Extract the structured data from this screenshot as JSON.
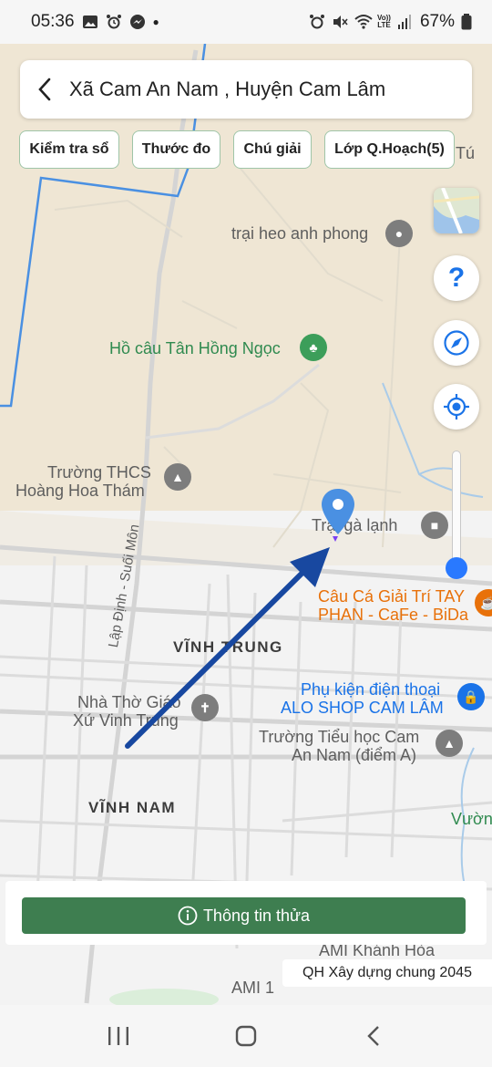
{
  "status_bar": {
    "time": "05:36",
    "battery_percent": "67%",
    "network_label_top": "Vo))",
    "network_label_bottom": "LTE"
  },
  "header": {
    "title": "Xã Cam An Nam , Huyện Cam Lâm"
  },
  "chips": [
    {
      "label": "Kiểm tra sổ"
    },
    {
      "label": "Thước đo"
    },
    {
      "label": "Chú giải"
    },
    {
      "label": "Lớp Q.Hoạch(5)"
    }
  ],
  "map": {
    "pois": {
      "trai_heo": "trại heo anh phong",
      "ho_cau": "Hồ câu Tân Hồng Ngọc",
      "truong_thcs_1": "Trường THCS",
      "truong_thcs_2": "Hoàng Hoa Thám",
      "trai_ga_1": "Trại gà lạnh",
      "cau_ca_1": "Câu Cá Giải Trí TAY",
      "cau_ca_2": "PHAN - CaFe - BiDa",
      "phu_kien_1": "Phụ kiện điện thoại",
      "phu_kien_2": "ALO SHOP CAM LÂM",
      "nha_tho_1": "Nhà Thờ Giáo",
      "nha_tho_2": "Xứ Vinh Trung",
      "truong_th_1": "Trường Tiểu học Cam",
      "truong_th_2": "An Nam (điểm A)",
      "vinh_trung": "VĨNH TRUNG",
      "vinh_nam": "VĨNH NAM",
      "road_1": "Lập Định - Suối Môn",
      "ami_1": "AMI Khánh Hòa",
      "ami_2": "AMI 1",
      "vuon": "Vườn",
      "tu": "Tú"
    },
    "zoom_level": 0.2
  },
  "bottom": {
    "info_button": "Thông tin thửa",
    "plan_label": "QH Xây dựng chung 2045"
  },
  "colors": {
    "primary_green": "#3e7e50",
    "chip_border": "#9fc5a8",
    "arrow_blue": "#1848a0",
    "boundary_blue": "#4a90e2",
    "slider_blue": "#2979ff"
  }
}
